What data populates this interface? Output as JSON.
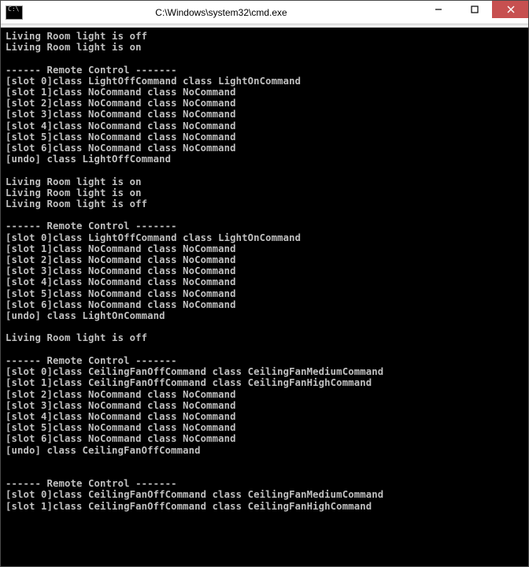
{
  "window": {
    "title": "C:\\Windows\\system32\\cmd.exe",
    "icon_label": "C:\\"
  },
  "terminal": {
    "lines": [
      "Living Room light is off",
      "Living Room light is on",
      "",
      "------ Remote Control -------",
      "[slot 0]class LightOffCommand class LightOnCommand",
      "[slot 1]class NoCommand class NoCommand",
      "[slot 2]class NoCommand class NoCommand",
      "[slot 3]class NoCommand class NoCommand",
      "[slot 4]class NoCommand class NoCommand",
      "[slot 5]class NoCommand class NoCommand",
      "[slot 6]class NoCommand class NoCommand",
      "[undo] class LightOffCommand",
      "",
      "Living Room light is on",
      "Living Room light is on",
      "Living Room light is off",
      "",
      "------ Remote Control -------",
      "[slot 0]class LightOffCommand class LightOnCommand",
      "[slot 1]class NoCommand class NoCommand",
      "[slot 2]class NoCommand class NoCommand",
      "[slot 3]class NoCommand class NoCommand",
      "[slot 4]class NoCommand class NoCommand",
      "[slot 5]class NoCommand class NoCommand",
      "[slot 6]class NoCommand class NoCommand",
      "[undo] class LightOnCommand",
      "",
      "Living Room light is off",
      "",
      "------ Remote Control -------",
      "[slot 0]class CeilingFanOffCommand class CeilingFanMediumCommand",
      "[slot 1]class CeilingFanOffCommand class CeilingFanHighCommand",
      "[slot 2]class NoCommand class NoCommand",
      "[slot 3]class NoCommand class NoCommand",
      "[slot 4]class NoCommand class NoCommand",
      "[slot 5]class NoCommand class NoCommand",
      "[slot 6]class NoCommand class NoCommand",
      "[undo] class CeilingFanOffCommand",
      "",
      "",
      "------ Remote Control -------",
      "[slot 0]class CeilingFanOffCommand class CeilingFanMediumCommand",
      "[slot 1]class CeilingFanOffCommand class CeilingFanHighCommand"
    ]
  }
}
